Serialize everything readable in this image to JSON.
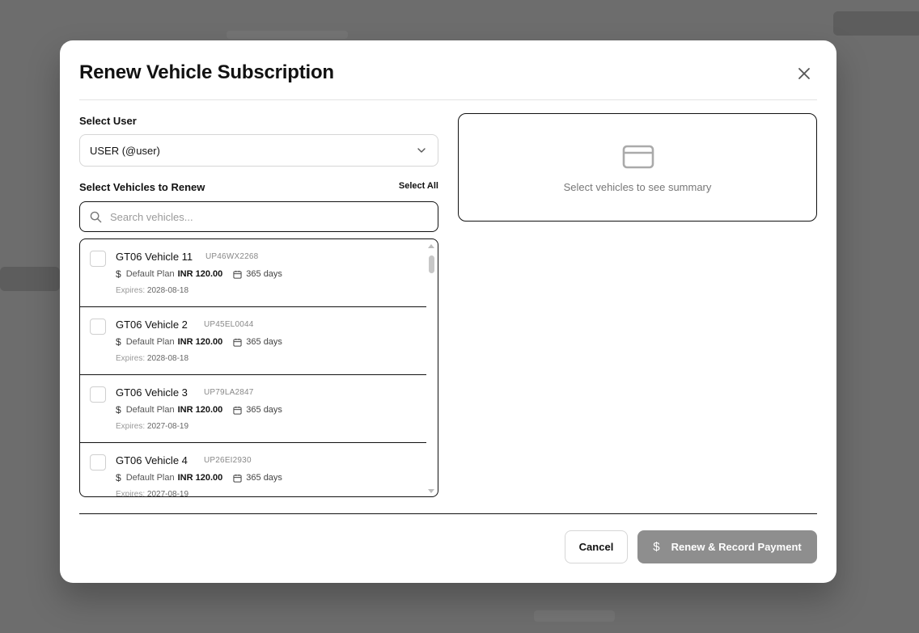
{
  "modal": {
    "title": "Renew Vehicle Subscription"
  },
  "select_user": {
    "label": "Select User",
    "value": "USER (@user)"
  },
  "vehicles_section": {
    "label": "Select Vehicles to Renew",
    "select_all": "Select All",
    "search_placeholder": "Search vehicles..."
  },
  "vehicles": [
    {
      "name": "GT06 Vehicle 11",
      "plate": "UP46WX2268",
      "plan": "Default Plan",
      "price": "INR 120.00",
      "duration": "365 days",
      "expires_label": "Expires:",
      "expires": "2028-08-18"
    },
    {
      "name": "GT06 Vehicle 2",
      "plate": "UP45EL0044",
      "plan": "Default Plan",
      "price": "INR 120.00",
      "duration": "365 days",
      "expires_label": "Expires:",
      "expires": "2028-08-18"
    },
    {
      "name": "GT06 Vehicle 3",
      "plate": "UP79LA2847",
      "plan": "Default Plan",
      "price": "INR 120.00",
      "duration": "365 days",
      "expires_label": "Expires:",
      "expires": "2027-08-19"
    },
    {
      "name": "GT06 Vehicle 4",
      "plate": "UP26EI2930",
      "plan": "Default Plan",
      "price": "INR 120.00",
      "duration": "365 days",
      "expires_label": "Expires:",
      "expires": "2027-08-19"
    }
  ],
  "summary": {
    "empty_text": "Select vehicles to see summary",
    "icon": "credit-card-icon"
  },
  "footer": {
    "cancel_label": "Cancel",
    "renew_label": "Renew & Record Payment",
    "renew_icon": "dollar-icon"
  },
  "colors": {
    "primary_disabled": "#8e8e8e",
    "backdrop": "#6f6f6f"
  }
}
